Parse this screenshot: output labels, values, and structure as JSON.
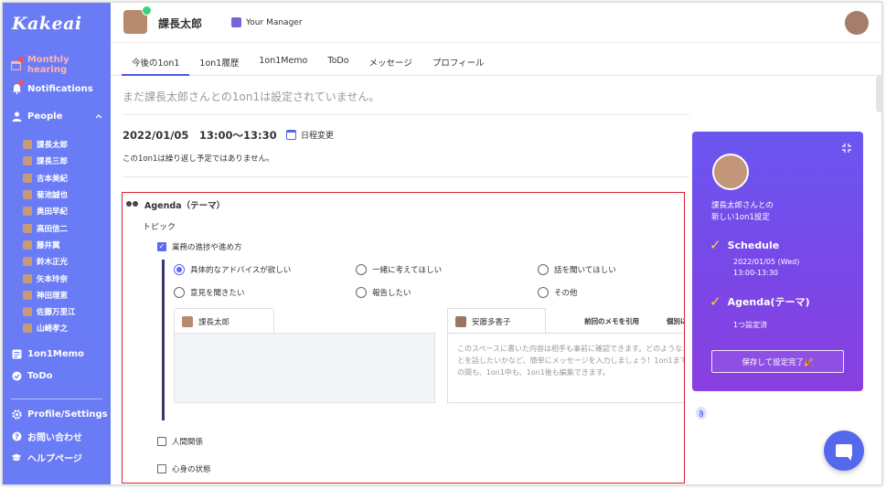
{
  "app": {
    "logo": "Kakeai"
  },
  "sidebar": {
    "nav": {
      "monthly": "Monthly hearing",
      "notifications": "Notifications",
      "people": "People",
      "memo": "1on1Memo",
      "todo": "ToDo",
      "profile": "Profile/Settings",
      "contact": "お問い合わせ",
      "help": "ヘルプページ"
    },
    "people": [
      "課長太郎",
      "課長三郎",
      "吉本美紀",
      "菊池誠也",
      "奥田早紀",
      "高田信二",
      "藤井翼",
      "鈴木正光",
      "矢本玲奈",
      "神田理恵",
      "佐藤万里江",
      "山崎孝之"
    ]
  },
  "header": {
    "name": "課長太郎",
    "manager_label": "Your Manager"
  },
  "tabs": [
    "今後の1on1",
    "1on1履歴",
    "1on1Memo",
    "ToDo",
    "メッセージ",
    "プロフィール"
  ],
  "main": {
    "title": "まだ課長太郎さんとの1on1は設定されていません。",
    "datetime": "2022/01/05　13:00〜13:30",
    "reschedule": "日程変更",
    "repeat_note": "この1on1は繰り返し予定ではありません。"
  },
  "agenda": {
    "header": "Agenda（テーマ）",
    "topic_label": "トピック",
    "topics": [
      {
        "label": "業務の進捗や進め方",
        "checked": true
      },
      {
        "label": "人間関係",
        "checked": false
      },
      {
        "label": "心身の状態",
        "checked": false
      }
    ],
    "radios": [
      {
        "label": "具体的なアドバイスが欲しい",
        "selected": true
      },
      {
        "label": "一緒に考えてほしい",
        "selected": false
      },
      {
        "label": "話を聞いてほしい",
        "selected": false
      },
      {
        "label": "意見を聞きたい",
        "selected": false
      },
      {
        "label": "報告したい",
        "selected": false
      },
      {
        "label": "その他",
        "selected": false
      }
    ],
    "memo_left_name": "課長太郎",
    "memo_right_name": "安藤多香子",
    "memo_link_prev": "前回のメモを引用",
    "memo_link_individual": "個別に表",
    "memo_placeholder": "このスペースに書いた内容は相手も事前に確認できます。どのようなことを話したいかなど、簡単にメッセージを入力しましょう！1on1までの間も、1on1中も、1on1後も編集できます。"
  },
  "panel": {
    "message_line1": "課長太郎さんとの",
    "message_line2": "新しい1on1設定",
    "schedule_title": "Schedule",
    "schedule_date": "2022/01/05 (Wed)",
    "schedule_time": "13:00-13:30",
    "agenda_title": "Agenda(テーマ)",
    "agenda_count": "1つ設定済",
    "save_button": "保存して設定完了🎉"
  },
  "colors": {
    "sidebar": "#6a7cf5",
    "accent": "#5b6cf0",
    "panel": "#7848e8",
    "highlight_box": "#d9232d"
  }
}
